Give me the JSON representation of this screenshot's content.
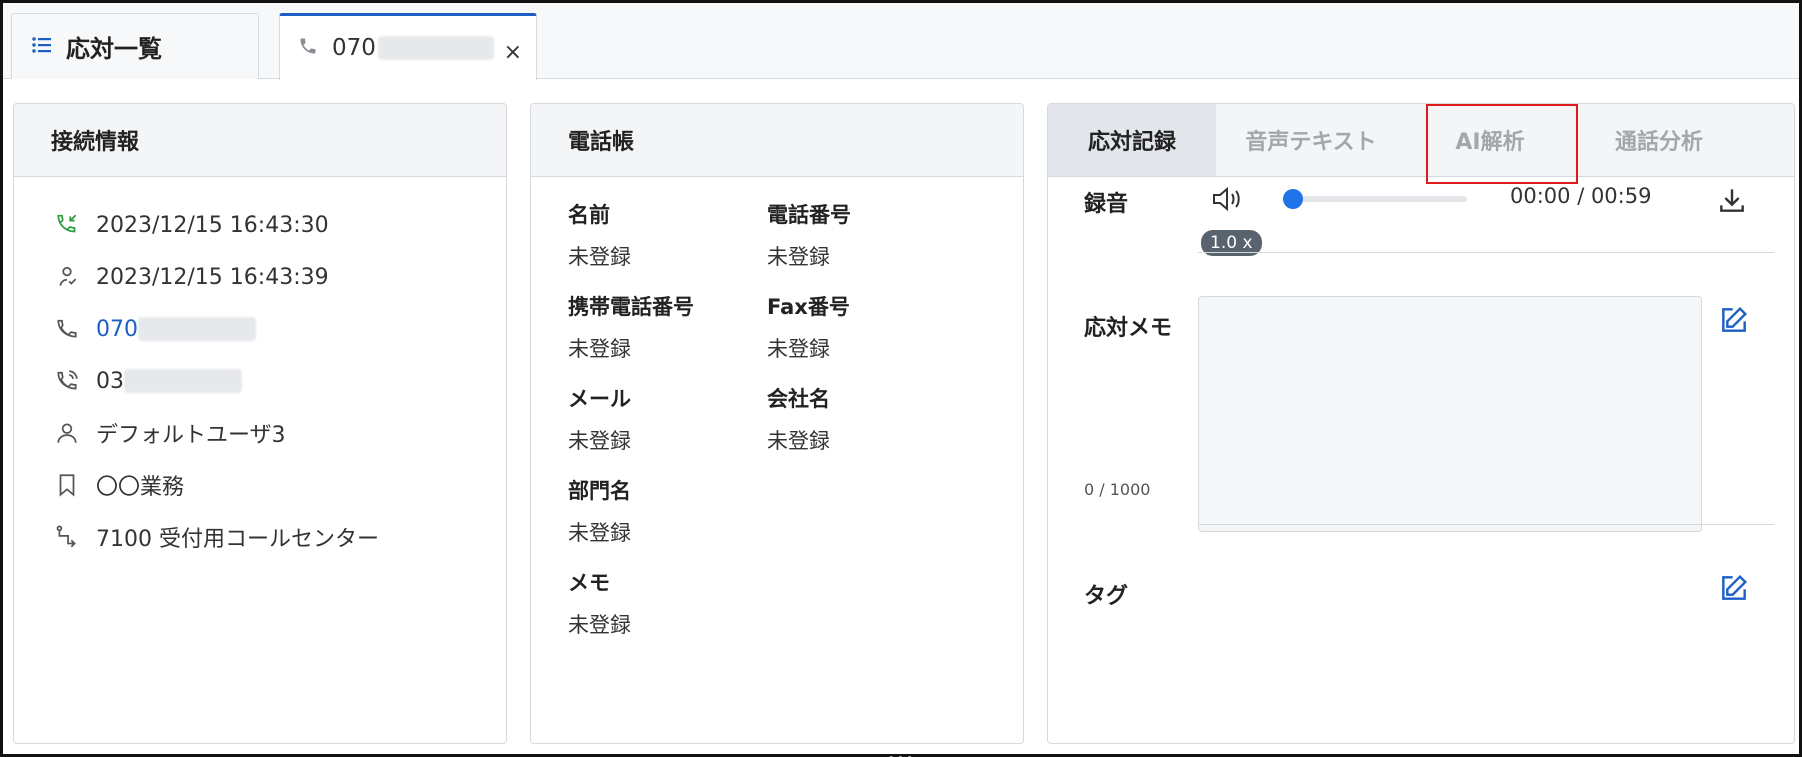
{
  "tabs": {
    "list_label": "応対一覧",
    "call_phone": "070",
    "close": "×"
  },
  "connection": {
    "title": "接続情報",
    "rows": [
      {
        "icon": "incoming-call-icon",
        "text": "2023/12/15 16:43:30"
      },
      {
        "icon": "agent-answer-icon",
        "text": "2023/12/15 16:43:39"
      },
      {
        "icon": "phone-icon",
        "text": "070"
      },
      {
        "icon": "phone-call-icon",
        "text": "03"
      },
      {
        "icon": "user-icon",
        "text": "デフォルトユーザ3"
      },
      {
        "icon": "bookmark-icon",
        "text": "〇〇業務"
      },
      {
        "icon": "route-icon",
        "text": "7100  受付用コールセンター"
      }
    ]
  },
  "phonebook": {
    "title": "電話帳",
    "fields": [
      {
        "label": "名前",
        "value": "未登録"
      },
      {
        "label": "電話番号",
        "value": "未登録"
      },
      {
        "label": "携帯電話番号",
        "value": "未登録"
      },
      {
        "label": "Fax番号",
        "value": "未登録"
      },
      {
        "label": "メール",
        "value": "未登録"
      },
      {
        "label": "会社名",
        "value": "未登録"
      },
      {
        "label": "部門名",
        "value": "未登録"
      },
      {
        "label": "メモ",
        "value": "未登録"
      }
    ]
  },
  "record": {
    "tabs": [
      "応対記録",
      "音声テキスト",
      "AI解析",
      "通話分析"
    ],
    "recording_label": "録音",
    "speed": "1.0 x",
    "progress": 0,
    "time": "00:00 / 00:59",
    "memo_label": "応対メモ",
    "memo_value": "",
    "memo_count": "0 / 1000",
    "tag_label": "タグ"
  },
  "colors": {
    "accent": "#1b5fc5",
    "incoming_green": "#2e9d3f",
    "highlight_red": "#e0191e",
    "slider_blue": "#1e74e8"
  }
}
